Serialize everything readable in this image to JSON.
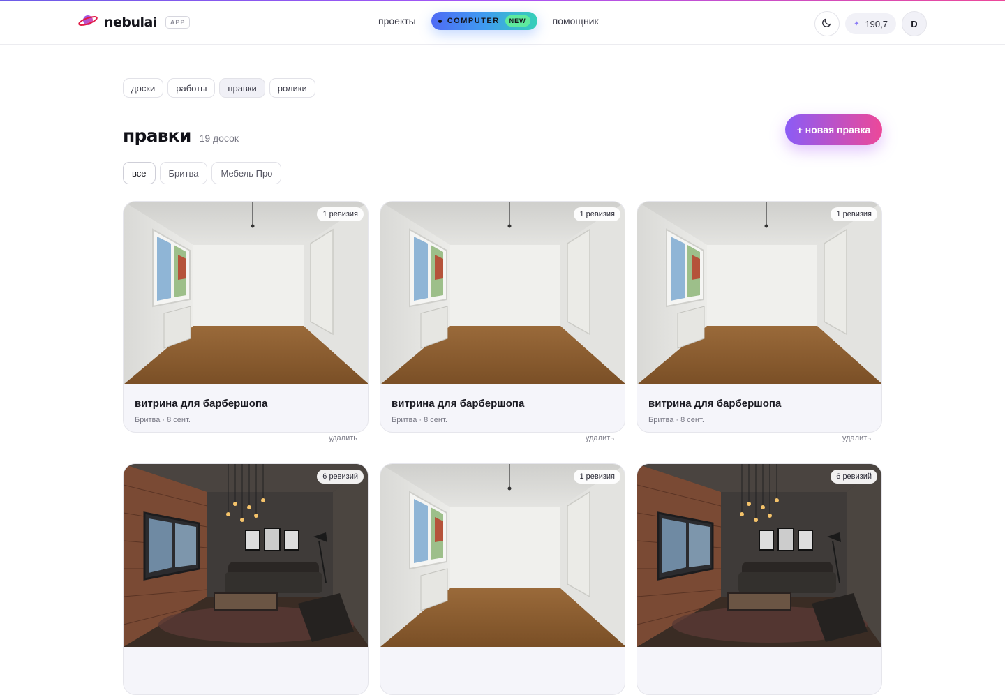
{
  "header": {
    "brand": "nebulai",
    "app_badge": "APP",
    "nav": {
      "projects": "проекты",
      "computer": "COMPUTER",
      "computer_badge": "NEW",
      "assistant": "помощник"
    },
    "credits": "190,7",
    "avatar_initial": "D"
  },
  "tabs": [
    {
      "label": "доски",
      "active": false
    },
    {
      "label": "работы",
      "active": false
    },
    {
      "label": "правки",
      "active": true
    },
    {
      "label": "ролики",
      "active": false
    }
  ],
  "page": {
    "title": "правки",
    "count": "19 досок",
    "new_button": "+ новая правка"
  },
  "filters": [
    {
      "label": "все",
      "active": true
    },
    {
      "label": "Бритва",
      "active": false
    },
    {
      "label": "Мебель Про",
      "active": false
    }
  ],
  "cards": [
    {
      "badge": "1 ревизия",
      "title": "витрина для барбершопа",
      "meta": "Бритва · 8 сент.",
      "delete": "удалить",
      "image": "empty-room"
    },
    {
      "badge": "1 ревизия",
      "title": "витрина для барбершопа",
      "meta": "Бритва · 8 сент.",
      "delete": "удалить",
      "image": "empty-room"
    },
    {
      "badge": "1 ревизия",
      "title": "витрина для барбершопа",
      "meta": "Бритва · 8 сент.",
      "delete": "удалить",
      "image": "empty-room"
    },
    {
      "badge": "6 ревизий",
      "image": "loft-living-room"
    },
    {
      "badge": "1 ревизия",
      "image": "empty-room"
    },
    {
      "badge": "6 ревизий",
      "image": "loft-living-room"
    }
  ]
}
